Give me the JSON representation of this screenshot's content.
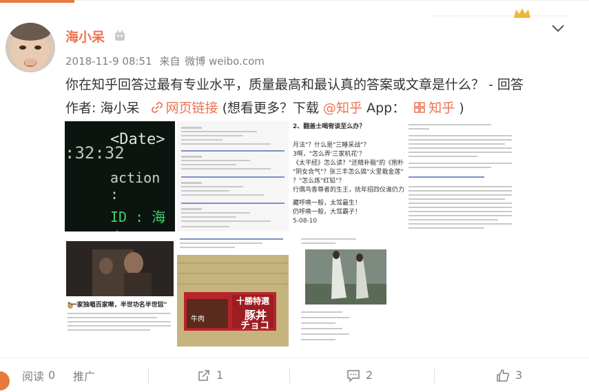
{
  "post": {
    "username": "海小呆",
    "date": "2018-11-9 08:51",
    "source_prefix": "来自",
    "source": "微博 weibo.com",
    "text_line1": "你在知乎回答过最有专业水平，质量最高和最认真的答案或文章是什么？ - 回答",
    "text_line2_prefix": "作者: 海小呆",
    "web_link": "网页链接",
    "text_line2_mid": "(想看更多？下载",
    "at_zhihu": "@知乎",
    "app_text": "App：",
    "zhihu_app_link": "知乎",
    "close_paren": ")"
  },
  "images": {
    "tile1_words": [
      ":32:32",
      "<Date>",
      "action : ",
      "ID : 海小"
    ],
    "tile4_caption": "\"一家独唱百家啭，半世功名半世愆\"",
    "tile5_box_text1": "牛肉",
    "tile5_box_text2": "十勝特選",
    "tile5_box_text3": "豚丼",
    "tile5_box_text4": "チョコ",
    "tile3_lines": [
      "2、翻盖士喝宥谈至么办？",
      "月法\"？什么是\"三睡采战\"？",
      "3啊，\"怎么弄'三家机花'？",
      "《太平经》怎么读？\"还精补脑\"的《抱朴子》如何念？",
      "\"阴女合气\"？张三丰怎么搞\"火里栽金莲\"",
      "？\"怎么炼\"红铅\"？",
      "行偶鸟香尊者的生王，抚年招四仪谁仍力金\"？",
      "藏呼唤一般，太驾最生！",
      "仍呼唤一般，大驾霸子！",
      "5-08-10"
    ]
  },
  "actions": {
    "reads_label": "阅读",
    "reads_count": "0",
    "promote_label": "推广",
    "repost_count": "1",
    "comment_count": "2",
    "like_count": "3"
  }
}
